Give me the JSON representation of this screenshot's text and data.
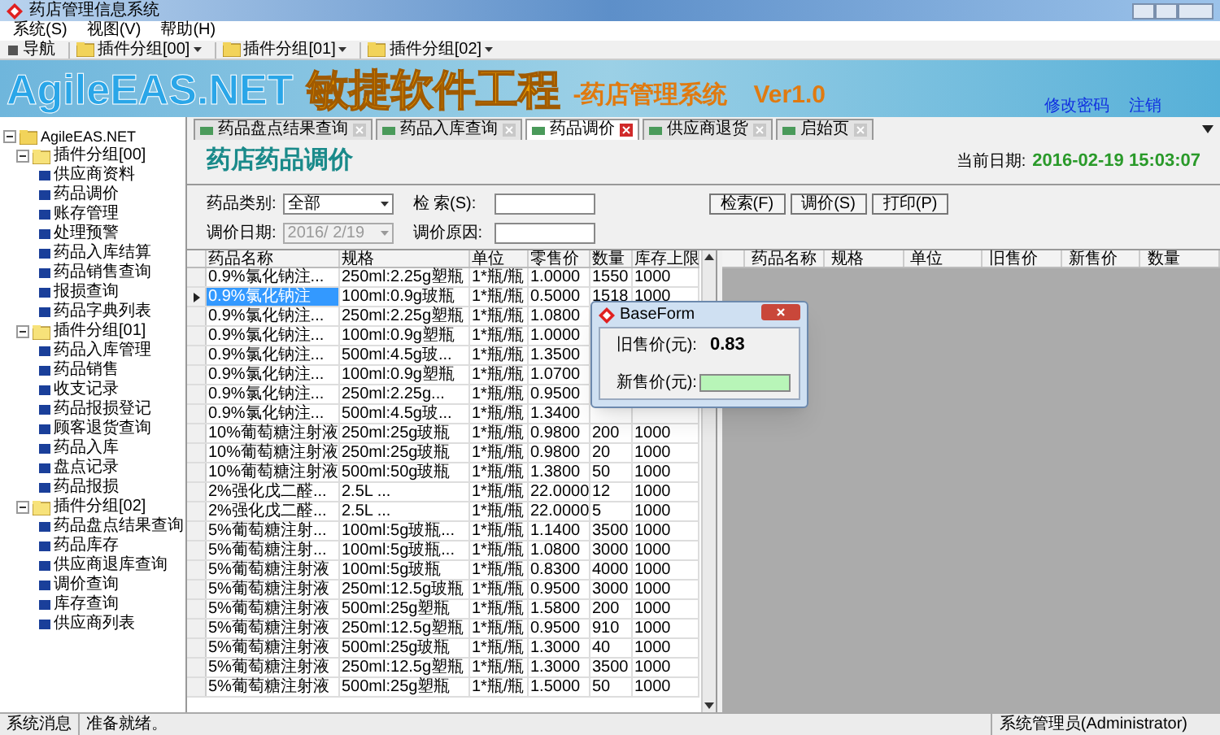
{
  "window": {
    "title": "药店管理信息系统"
  },
  "menu": [
    "系统(S)",
    "视图(V)",
    "帮助(H)"
  ],
  "toolbar": {
    "nav": "导航",
    "groups": [
      "插件分组[00]",
      "插件分组[01]",
      "插件分组[02]"
    ]
  },
  "banner": {
    "brand": "AgileEAS.NET",
    "slogan": "敏捷软件工程",
    "product": "-药店管理系统",
    "version": "Ver1.0",
    "links": [
      "修改密码",
      "注销"
    ]
  },
  "tabs": [
    {
      "label": "药品盘点结果查询",
      "selected": false
    },
    {
      "label": "药品入库查询",
      "selected": false
    },
    {
      "label": "药品调价",
      "selected": true
    },
    {
      "label": "供应商退货",
      "selected": false
    },
    {
      "label": "启始页",
      "selected": false
    }
  ],
  "tree": {
    "label": "AgileEAS.NET",
    "expanded": true,
    "children": [
      {
        "label": "插件分组[00]",
        "expanded": true,
        "children": [
          {
            "label": "供应商资料"
          },
          {
            "label": "药品调价"
          },
          {
            "label": "账存管理"
          },
          {
            "label": "处理预警"
          },
          {
            "label": "药品入库结算"
          },
          {
            "label": "药品销售查询"
          },
          {
            "label": "报损查询"
          },
          {
            "label": "药品字典列表"
          }
        ]
      },
      {
        "label": "插件分组[01]",
        "expanded": true,
        "children": [
          {
            "label": "药品入库管理"
          },
          {
            "label": "药品销售"
          },
          {
            "label": "收支记录"
          },
          {
            "label": "药品报损登记"
          },
          {
            "label": "顾客退货查询"
          },
          {
            "label": "药品入库"
          },
          {
            "label": "盘点记录"
          },
          {
            "label": "药品报损"
          }
        ]
      },
      {
        "label": "插件分组[02]",
        "expanded": true,
        "children": [
          {
            "label": "药品盘点结果查询"
          },
          {
            "label": "药品库存"
          },
          {
            "label": "供应商退库查询"
          },
          {
            "label": "调价查询"
          },
          {
            "label": "库存查询"
          },
          {
            "label": "供应商列表"
          }
        ]
      }
    ]
  },
  "page": {
    "title": "药店药品调价",
    "date_label": "当前日期:",
    "date": "2016-02-19 15:03:07"
  },
  "filters": {
    "category_label": "药品类别:",
    "category": "全部",
    "search_label": "检 索(S):",
    "date_label": "调价日期:",
    "date": "2016/ 2/19",
    "date_disabled": true,
    "reason_label": "调价原因:"
  },
  "buttons": [
    "检索(F)",
    "调价(S)",
    "打印(P)"
  ],
  "table": {
    "columns": [
      "药品名称",
      "规格",
      "单位",
      "零售价",
      "数量",
      "库存上限"
    ],
    "rows": [
      {
        "selected": false,
        "cells": [
          "0.9%氯化钠注...",
          "250ml:2.25g塑瓶",
          "1*瓶/瓶",
          "1.0000",
          "1550",
          "1000"
        ]
      },
      {
        "selected": true,
        "cells": [
          "0.9%氯化钠注",
          "100ml:0.9g玻瓶",
          "1*瓶/瓶",
          "0.5000",
          "1518",
          "1000"
        ]
      },
      {
        "selected": false,
        "cells": [
          "0.9%氯化钠注...",
          "250ml:2.25g塑瓶",
          "1*瓶/瓶",
          "1.0800"
        ]
      },
      {
        "selected": false,
        "cells": [
          "0.9%氯化钠注...",
          "100ml:0.9g塑瓶",
          "1*瓶/瓶",
          "1.0000"
        ]
      },
      {
        "selected": false,
        "cells": [
          "0.9%氯化钠注...",
          "500ml:4.5g玻...",
          "1*瓶/瓶",
          "1.3500"
        ]
      },
      {
        "selected": false,
        "cells": [
          "0.9%氯化钠注...",
          "100ml:0.9g塑瓶",
          "1*瓶/瓶",
          "1.0700"
        ]
      },
      {
        "selected": false,
        "cells": [
          "0.9%氯化钠注...",
          "250ml:2.25g...",
          "1*瓶/瓶",
          "0.9500"
        ]
      },
      {
        "selected": false,
        "cells": [
          "0.9%氯化钠注...",
          "500ml:4.5g玻...",
          "1*瓶/瓶",
          "1.3400"
        ]
      },
      {
        "selected": false,
        "cells": [
          "10%葡萄糖注射液",
          "250ml:25g玻瓶",
          "1*瓶/瓶",
          "0.9800",
          "200",
          "1000"
        ]
      },
      {
        "selected": false,
        "cells": [
          "10%葡萄糖注射液",
          "250ml:25g玻瓶",
          "1*瓶/瓶",
          "0.9800",
          "20",
          "1000"
        ]
      },
      {
        "selected": false,
        "cells": [
          "10%葡萄糖注射液",
          "500ml:50g玻瓶",
          "1*瓶/瓶",
          "1.3800",
          "50",
          "1000"
        ]
      },
      {
        "selected": false,
        "cells": [
          "2%强化戊二醛...",
          "2.5L ...",
          "1*瓶/瓶",
          "22.0000",
          "12",
          "1000"
        ]
      },
      {
        "selected": false,
        "cells": [
          "2%强化戊二醛...",
          "2.5L ...",
          "1*瓶/瓶",
          "22.0000",
          "5",
          "1000"
        ]
      },
      {
        "selected": false,
        "cells": [
          "5%葡萄糖注射...",
          "100ml:5g玻瓶...",
          "1*瓶/瓶",
          "1.1400",
          "3500",
          "1000"
        ]
      },
      {
        "selected": false,
        "cells": [
          "5%葡萄糖注射...",
          "100ml:5g玻瓶...",
          "1*瓶/瓶",
          "1.0800",
          "3000",
          "1000"
        ]
      },
      {
        "selected": false,
        "cells": [
          "5%葡萄糖注射液",
          "100ml:5g玻瓶",
          "1*瓶/瓶",
          "0.8300",
          "4000",
          "1000"
        ]
      },
      {
        "selected": false,
        "cells": [
          "5%葡萄糖注射液",
          "250ml:12.5g玻瓶",
          "1*瓶/瓶",
          "0.9500",
          "3000",
          "1000"
        ]
      },
      {
        "selected": false,
        "cells": [
          "5%葡萄糖注射液",
          "500ml:25g塑瓶",
          "1*瓶/瓶",
          "1.5800",
          "200",
          "1000"
        ]
      },
      {
        "selected": false,
        "cells": [
          "5%葡萄糖注射液",
          "250ml:12.5g塑瓶",
          "1*瓶/瓶",
          "0.9500",
          "910",
          "1000"
        ]
      },
      {
        "selected": false,
        "cells": [
          "5%葡萄糖注射液",
          "500ml:25g玻瓶",
          "1*瓶/瓶",
          "1.3000",
          "40",
          "1000"
        ]
      },
      {
        "selected": false,
        "cells": [
          "5%葡萄糖注射液",
          "250ml:12.5g塑瓶",
          "1*瓶/瓶",
          "1.3000",
          "3500",
          "1000"
        ]
      },
      {
        "selected": false,
        "cells": [
          "5%葡萄糖注射液",
          "500ml:25g塑瓶",
          "1*瓶/瓶",
          "1.5000",
          "50",
          "1000"
        ]
      }
    ]
  },
  "adjust_table": {
    "columns": [
      "药品名称",
      "规格",
      "单位",
      "旧售价",
      "新售价",
      "数量"
    ]
  },
  "dialog": {
    "title": "BaseForm",
    "old_label": "旧售价(元):",
    "old_value": "0.83",
    "new_label": "新售价(元):"
  },
  "status_bar": [
    "系统消息",
    "准备就绪。",
    "系统管理员(Administrator)"
  ]
}
